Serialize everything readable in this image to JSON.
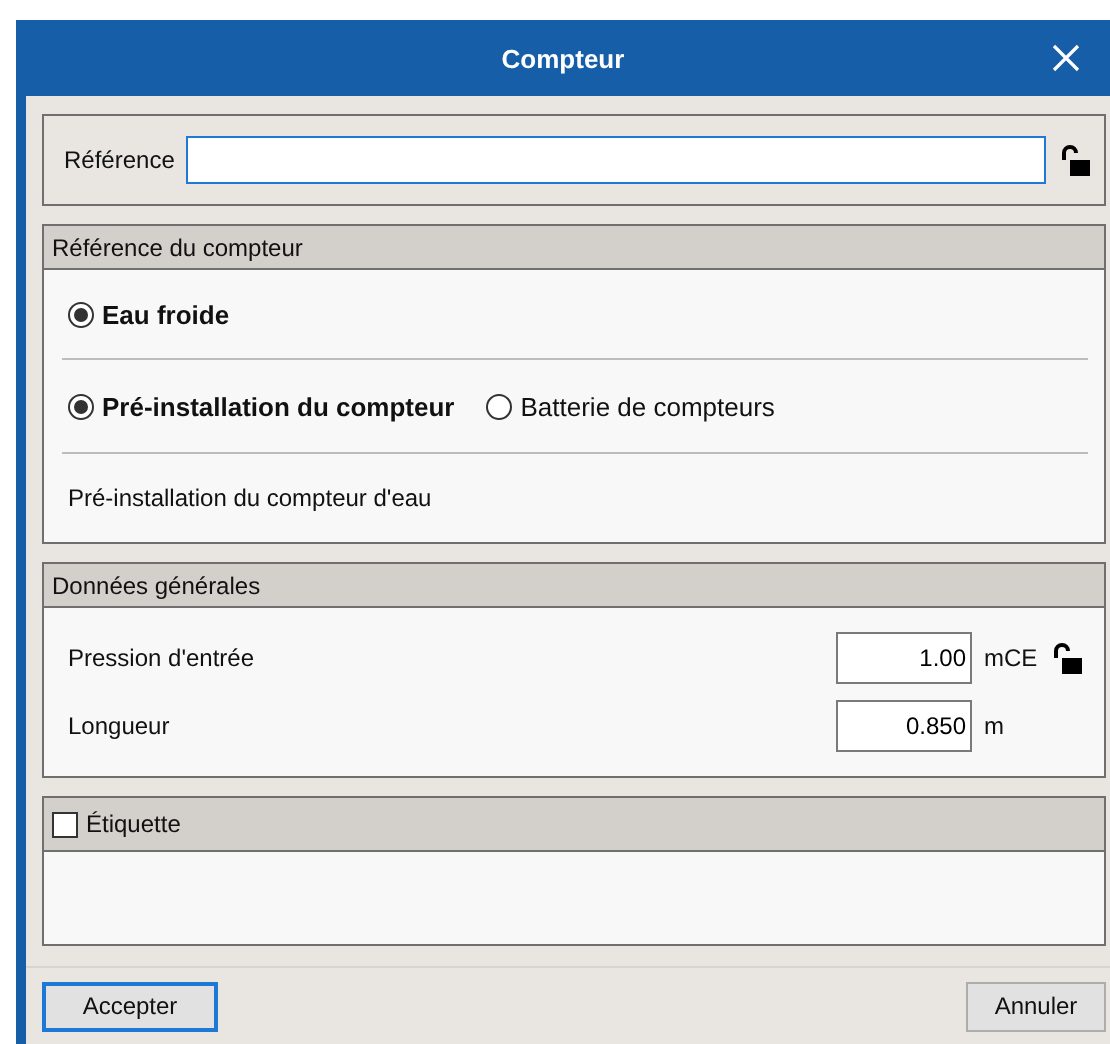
{
  "window": {
    "title": "Compteur"
  },
  "reference": {
    "label": "Référence"
  },
  "meter_reference": {
    "title": "Référence du compteur",
    "fluid": [
      {
        "label": "Eau froide",
        "selected": true
      }
    ],
    "installation": [
      {
        "label": "Pré-installation du compteur",
        "selected": true
      },
      {
        "label": "Batterie de compteurs",
        "selected": false
      }
    ],
    "description": "Pré-installation du compteur d'eau"
  },
  "general": {
    "title": "Données générales",
    "fields": [
      {
        "label": "Pression d'entrée",
        "value": "1.00",
        "unit": "mCE",
        "lock": true
      },
      {
        "label": "Longueur",
        "value": "0.850",
        "unit": "m",
        "lock": false
      }
    ]
  },
  "label_section": {
    "title": "Étiquette",
    "checked": false
  },
  "buttons": [
    {
      "label": "Accepter",
      "default": true
    },
    {
      "label": "Annuler",
      "default": false
    }
  ]
}
